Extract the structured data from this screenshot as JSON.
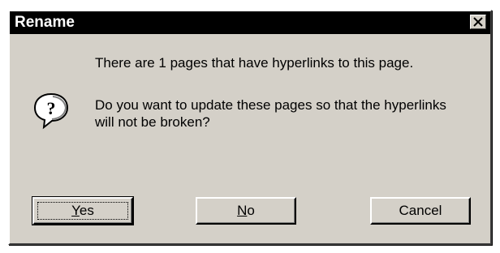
{
  "window": {
    "title": "Rename",
    "close_glyph": "×"
  },
  "dialog": {
    "message_line1": "There are 1 pages that have hyperlinks to this page.",
    "message_line2": "Do you want to update these pages so that the hyperlinks will not be broken?",
    "icon": "question-icon"
  },
  "buttons": {
    "yes": {
      "mnemonic": "Y",
      "rest": "es"
    },
    "no": {
      "mnemonic": "N",
      "rest": "o"
    },
    "cancel": {
      "label": "Cancel"
    }
  },
  "colors": {
    "titlebar": "#000000",
    "face": "#d4d0c8"
  }
}
